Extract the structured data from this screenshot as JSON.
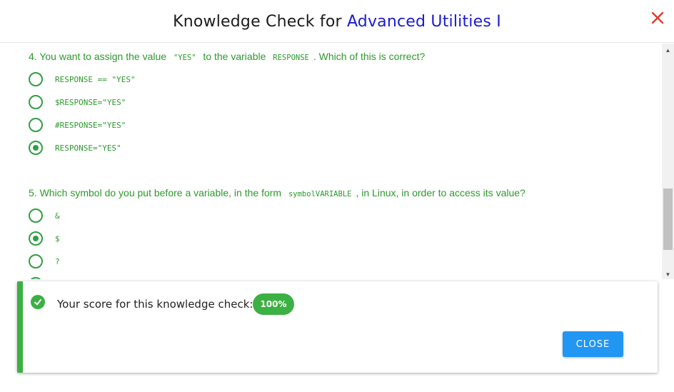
{
  "header": {
    "title_prefix": "Knowledge Check for ",
    "course_name": "Advanced Utilities I",
    "close_icon": "close-x-icon"
  },
  "questions": [
    {
      "text_before": "4. You want to assign the value ",
      "code1": "\"YES\"",
      "text_middle": " to the variable ",
      "code2": "RESPONSE",
      "text_after": ". Which of this is correct?",
      "options": [
        {
          "label": "RESPONSE == \"YES\"",
          "selected": false
        },
        {
          "label": "$RESPONSE=\"YES\"",
          "selected": false
        },
        {
          "label": "#RESPONSE=\"YES\"",
          "selected": false
        },
        {
          "label": "RESPONSE=\"YES\"",
          "selected": true
        }
      ]
    },
    {
      "text_before": "5. Which symbol do you put before a variable, in the form ",
      "code1": "symbolVARIABLE",
      "text_after": ", in Linux, in order to access its value?",
      "options": [
        {
          "label": "&",
          "selected": false
        },
        {
          "label": "$",
          "selected": true
        },
        {
          "label": "?",
          "selected": false
        }
      ]
    }
  ],
  "score": {
    "text": "Your score for this knowledge check:",
    "value": "100%",
    "close_label": "CLOSE"
  },
  "colors": {
    "accent_green": "#3cb043",
    "text_green": "#2c9a2c",
    "course_blue": "#1a1ad6",
    "close_red": "#e03c2c",
    "button_blue": "#2196f3"
  }
}
